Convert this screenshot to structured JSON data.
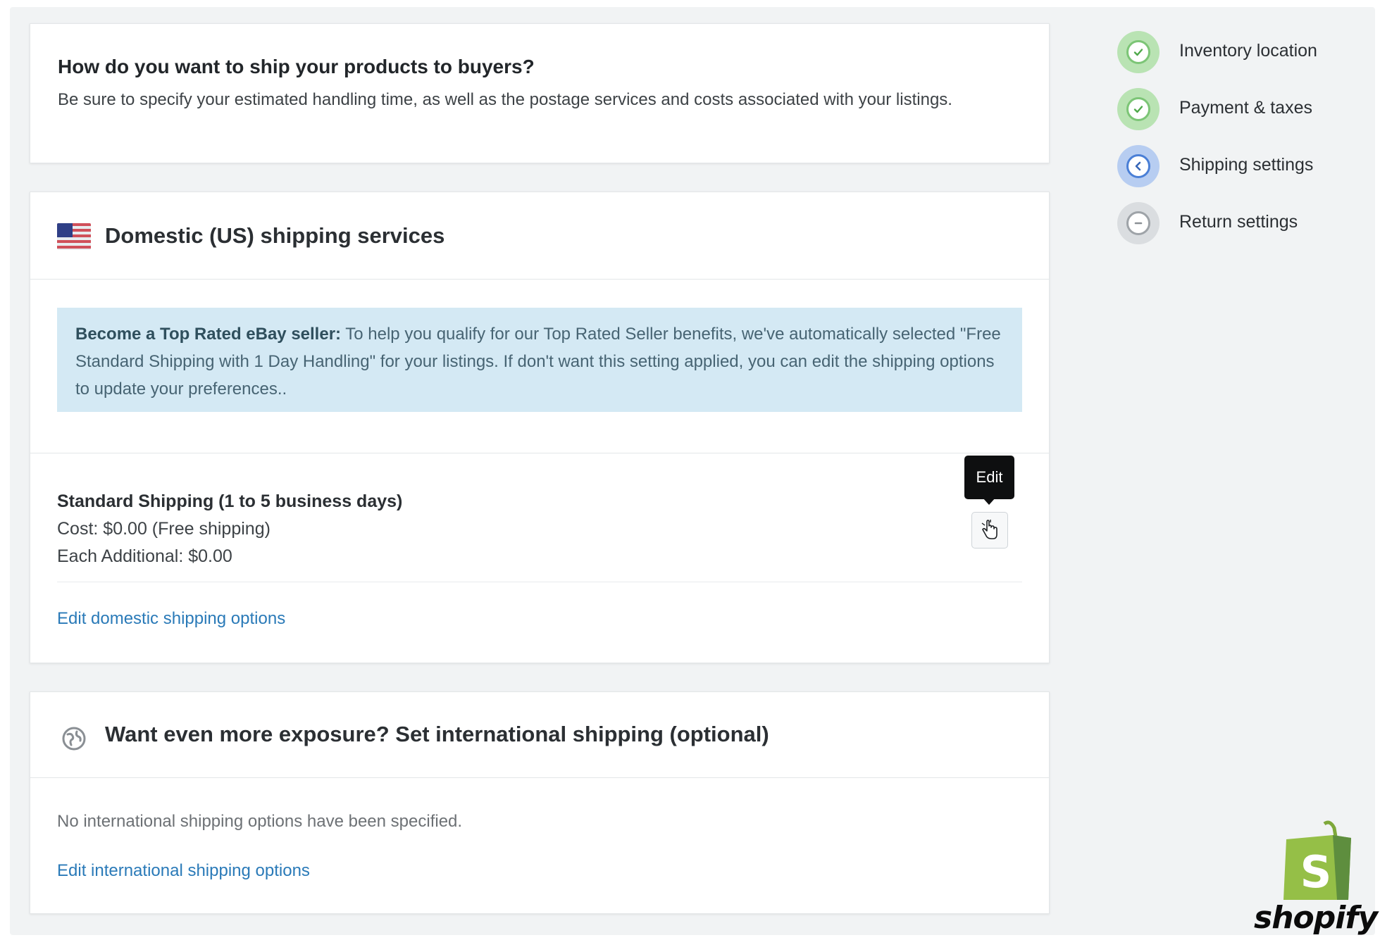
{
  "intro": {
    "title": "How do you want to ship your products to buyers?",
    "description": "Be sure to specify your estimated handling time, as well as the postage services and costs associated with your listings."
  },
  "domestic": {
    "title": "Domestic (US) shipping services",
    "banner_bold": "Become a Top Rated eBay seller:",
    "banner_text": " To help you qualify for our Top Rated Seller benefits, we've automatically selected \"Free Standard Shipping with 1 Day Handling\" for your listings. If don't want this setting applied, you can edit the shipping options to update your preferences..",
    "service": {
      "name": "Standard Shipping (1 to 5 business days)",
      "cost": "Cost: $0.00 (Free shipping)",
      "additional": "Each Additional: $0.00"
    },
    "tooltip": "Edit",
    "edit_link": "Edit domestic shipping options"
  },
  "international": {
    "title": "Want even more exposure? Set international shipping (optional)",
    "empty_text": "No international shipping options have been specified.",
    "edit_link": "Edit international shipping options"
  },
  "steps": [
    {
      "label": "Inventory location",
      "state": "complete",
      "icon": "check-icon"
    },
    {
      "label": "Payment & taxes",
      "state": "complete",
      "icon": "check-icon"
    },
    {
      "label": "Shipping settings",
      "state": "current",
      "icon": "chevron-left-icon"
    },
    {
      "label": "Return settings",
      "state": "pending",
      "icon": "minus-icon"
    }
  ],
  "colors": {
    "complete": "#7cc576",
    "current": "#6f9ee3",
    "pending": "#c4c8cc",
    "link": "#2a7ab8",
    "banner": "#d4e9f4",
    "brand_green": "#95bf47"
  },
  "logo": {
    "wordmark": "shopify",
    "mark_letter": "S"
  }
}
